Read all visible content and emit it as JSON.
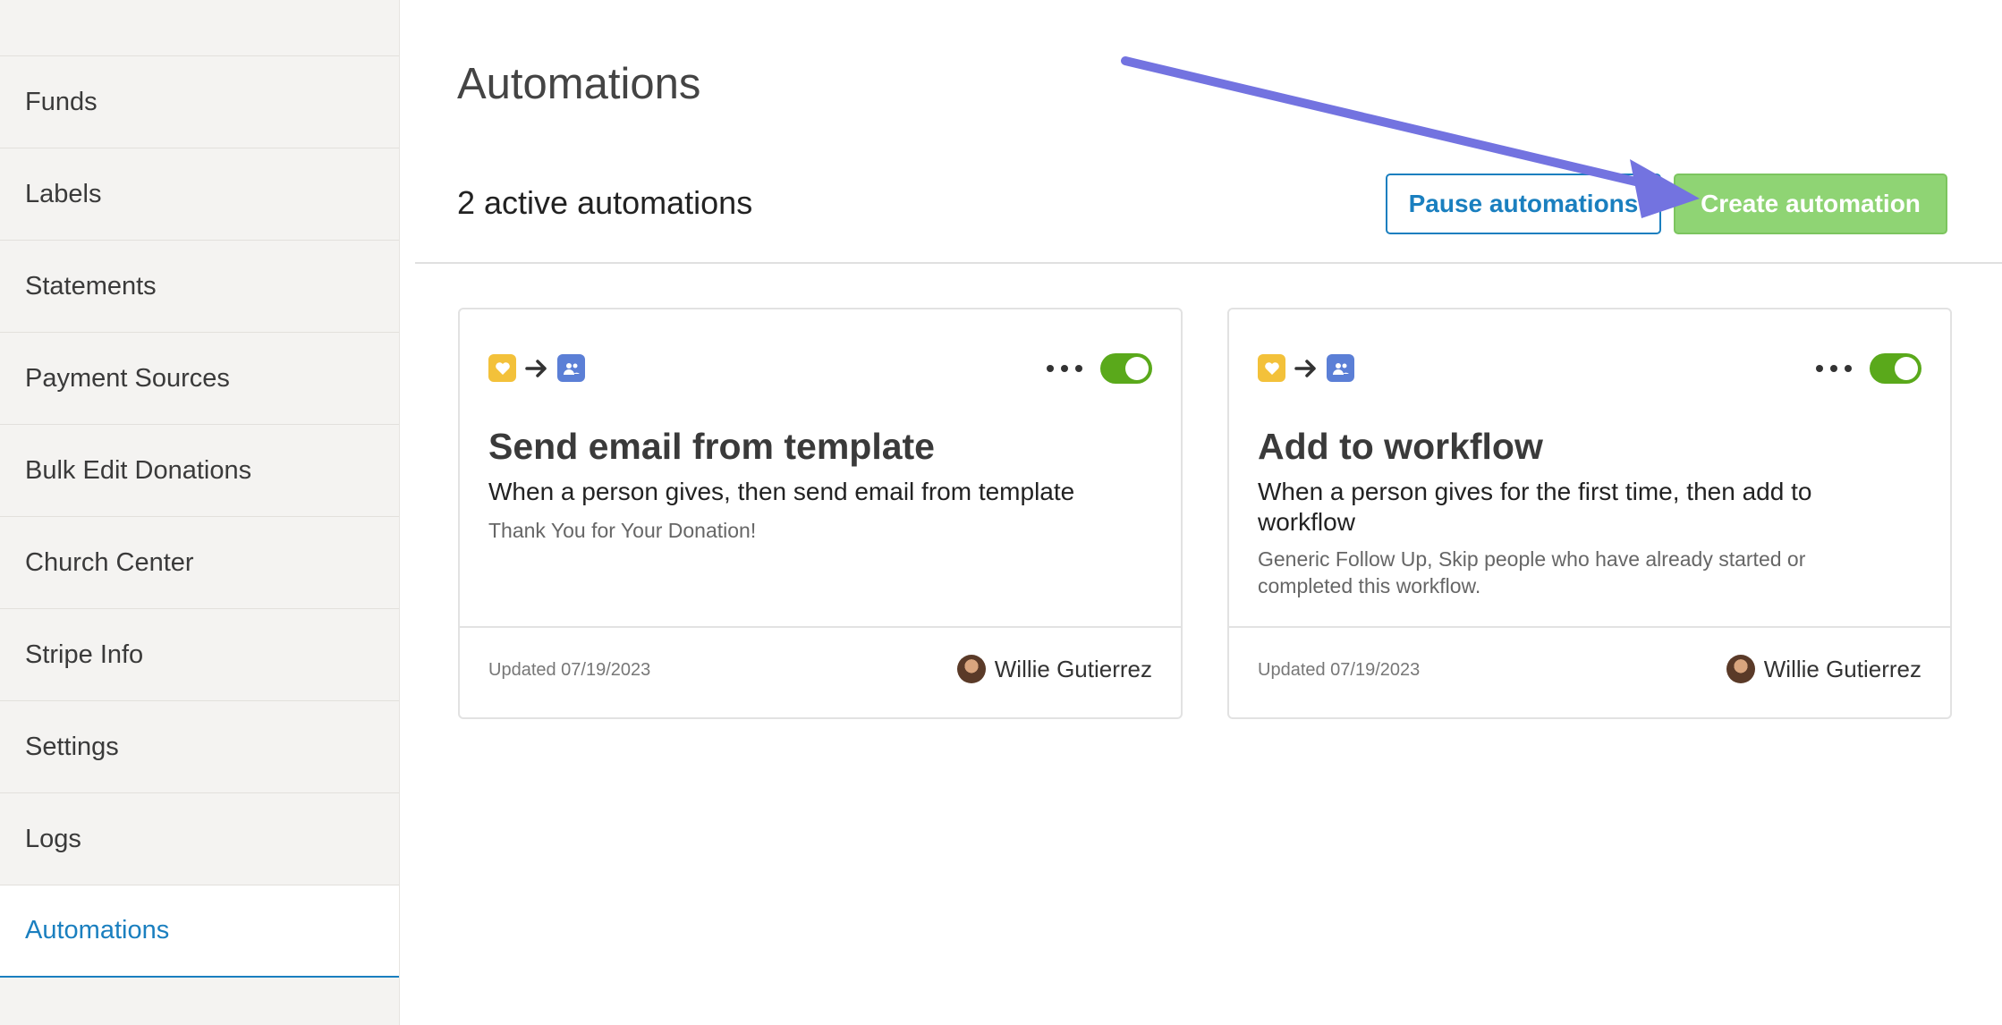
{
  "sidebar": {
    "items": [
      {
        "label": "Funds"
      },
      {
        "label": "Labels"
      },
      {
        "label": "Statements"
      },
      {
        "label": "Payment Sources"
      },
      {
        "label": "Bulk Edit Donations"
      },
      {
        "label": "Church Center"
      },
      {
        "label": "Stripe Info"
      },
      {
        "label": "Settings"
      },
      {
        "label": "Logs"
      },
      {
        "label": "Automations",
        "active": true
      }
    ]
  },
  "main": {
    "title": "Automations",
    "count_text": "2 active automations",
    "pause_label": "Pause automations",
    "create_label": "Create automation"
  },
  "cards": [
    {
      "title": "Send email from template",
      "description": "When a person gives, then send email from template",
      "sub": "Thank You for Your Donation!",
      "updated": "Updated 07/19/2023",
      "author": "Willie Gutierrez",
      "enabled": true
    },
    {
      "title": "Add to workflow",
      "description": "When a person gives for the first time, then add to workflow",
      "sub": "Generic Follow Up, Skip people who have already started or completed this workflow.",
      "updated": "Updated 07/19/2023",
      "author": "Willie Gutierrez",
      "enabled": true
    }
  ],
  "colors": {
    "accent": "#1a7fbf",
    "create_button": "#8fd474",
    "toggle_on": "#5aa91b",
    "annotation_arrow": "#7373e0"
  }
}
